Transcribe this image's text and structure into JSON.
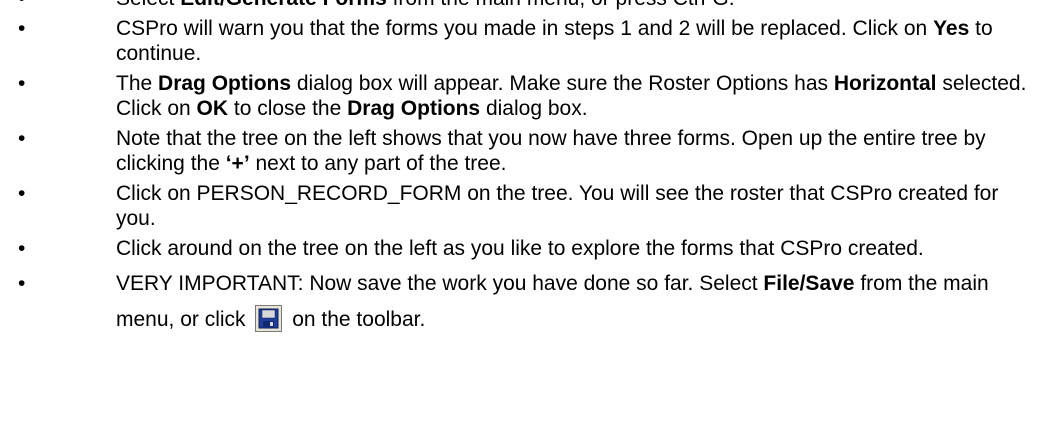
{
  "document": {
    "bullet_symbol": "•",
    "items": [
      {
        "parts": [
          {
            "text": "Select "
          },
          {
            "text": "Edit/Generate Forms",
            "bold": true
          },
          {
            "text": " from the main menu, or press Ctrl-G."
          }
        ]
      },
      {
        "parts": [
          {
            "text": "CSPro will warn you that the forms you made in steps 1 and 2 will be replaced. Click on "
          },
          {
            "text": "Yes",
            "bold": true
          },
          {
            "text": " to continue."
          }
        ]
      },
      {
        "parts": [
          {
            "text": "The "
          },
          {
            "text": "Drag Options",
            "bold": true
          },
          {
            "text": " dialog box will appear. Make sure the Roster Options has "
          },
          {
            "text": "Horizontal",
            "bold": true
          },
          {
            "text": " selected. Click on "
          },
          {
            "text": "OK",
            "bold": true
          },
          {
            "text": " to close the "
          },
          {
            "text": "Drag Options",
            "bold": true
          },
          {
            "text": " dialog box."
          }
        ]
      },
      {
        "parts": [
          {
            "text": "Note that the tree on the left shows that you now have three forms. Open up the entire tree by clicking the "
          },
          {
            "text": "‘+’",
            "bold": true
          },
          {
            "text": " next to any part of the tree."
          }
        ]
      },
      {
        "parts": [
          {
            "text": "Click on PERSON_RECORD_FORM on the tree. You will see the roster that CSPro created for you."
          }
        ]
      },
      {
        "parts": [
          {
            "text": "Click around on the tree on the left as you like to explore the forms that CSPro created."
          }
        ]
      },
      {
        "tall": true,
        "parts": [
          {
            "text": "VERY IMPORTANT: Now save the work you have done so far. Select "
          },
          {
            "text": "File/Save",
            "bold": true
          },
          {
            "text": " from the main menu, or click "
          },
          {
            "icon": "floppy-disk-save-icon"
          },
          {
            "text": " on the toolbar."
          }
        ]
      }
    ]
  },
  "colors": {
    "text": "#000000",
    "background": "#ffffff",
    "icon_body": "#1f3d99",
    "icon_label": "#d8d8d8",
    "icon_button": "#e8e4d6"
  }
}
